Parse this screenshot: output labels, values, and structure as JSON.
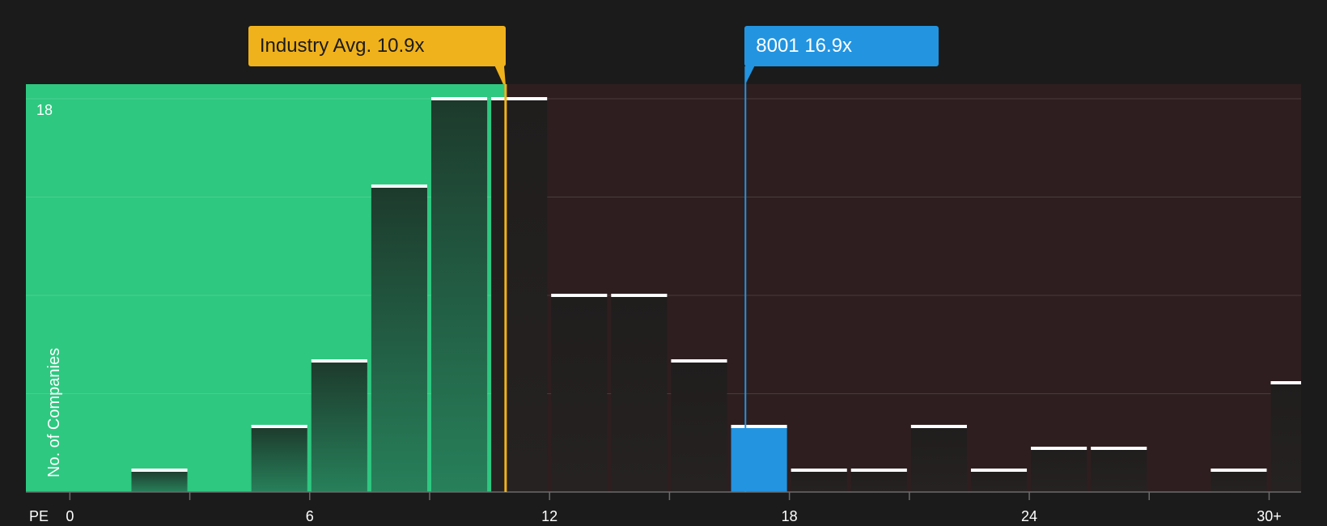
{
  "chart_data": {
    "type": "bar",
    "xlabel": "PE",
    "ylabel": "No. of Companies",
    "x_ticks": [
      {
        "value": 0,
        "label": "0"
      },
      {
        "value": 6,
        "label": "6"
      },
      {
        "value": 12,
        "label": "12"
      },
      {
        "value": 18,
        "label": "18"
      },
      {
        "value": 24,
        "label": "24"
      },
      {
        "value": 30,
        "label": "30+"
      }
    ],
    "xlim": [
      -1.1,
      30.8
    ],
    "y_max_label": "18",
    "ylim": [
      0,
      18
    ],
    "bin_width": 1.5,
    "bars": [
      {
        "x_start": 1.5,
        "value": 1
      },
      {
        "x_start": 4.5,
        "value": 3
      },
      {
        "x_start": 6.0,
        "value": 6
      },
      {
        "x_start": 7.5,
        "value": 14
      },
      {
        "x_start": 9.0,
        "value": 18
      },
      {
        "x_start": 10.5,
        "value": 18
      },
      {
        "x_start": 12.0,
        "value": 9
      },
      {
        "x_start": 13.5,
        "value": 9
      },
      {
        "x_start": 15.0,
        "value": 6
      },
      {
        "x_start": 16.5,
        "value": 3,
        "highlight": true
      },
      {
        "x_start": 18.0,
        "value": 1
      },
      {
        "x_start": 19.5,
        "value": 1
      },
      {
        "x_start": 21.0,
        "value": 3
      },
      {
        "x_start": 22.5,
        "value": 1
      },
      {
        "x_start": 24.0,
        "value": 2
      },
      {
        "x_start": 25.5,
        "value": 2
      },
      {
        "x_start": 28.5,
        "value": 1
      },
      {
        "x_start": 30.0,
        "value": 5
      }
    ],
    "industry_avg": {
      "value": 10.9,
      "label": "Industry Avg. 10.9x"
    },
    "company": {
      "value": 16.9,
      "label": "8001 16.9x"
    },
    "grid": true,
    "colors": {
      "background": "#1b1b1b",
      "undervalued_zone": "#2ec880",
      "overvalued_zone": "#2e1e1f",
      "industry": "#f0b21c",
      "company": "#2394e0"
    }
  }
}
